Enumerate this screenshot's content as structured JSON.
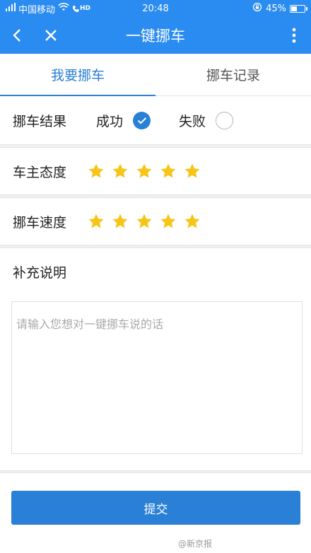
{
  "status_bar": {
    "signal_label": "中国移动",
    "volte": "HD",
    "time": "20:48",
    "battery_percent": "45%",
    "battery_level": 0.45
  },
  "app_bar": {
    "title": "一键挪车",
    "icons": [
      "back-icon",
      "close-icon",
      "more-vert-icon"
    ]
  },
  "tabs": [
    {
      "label": "我要挪车",
      "active": true
    },
    {
      "label": "挪车记录",
      "active": false
    }
  ],
  "result": {
    "label": "挪车结果",
    "options": [
      {
        "label": "成功",
        "selected": true
      },
      {
        "label": "失败",
        "selected": false
      }
    ]
  },
  "owner_attitude": {
    "label": "车主态度",
    "rating": 5,
    "max": 5
  },
  "move_speed": {
    "label": "挪车速度",
    "rating": 5,
    "max": 5
  },
  "notes": {
    "label": "补充说明",
    "placeholder": "请输入您想对一键挪车说的话",
    "value": ""
  },
  "submit_label": "提交",
  "watermark": "@新京报",
  "colors": {
    "primary": "#2a8bf0",
    "accent": "#2a7fd6",
    "star": "#f7c518"
  }
}
